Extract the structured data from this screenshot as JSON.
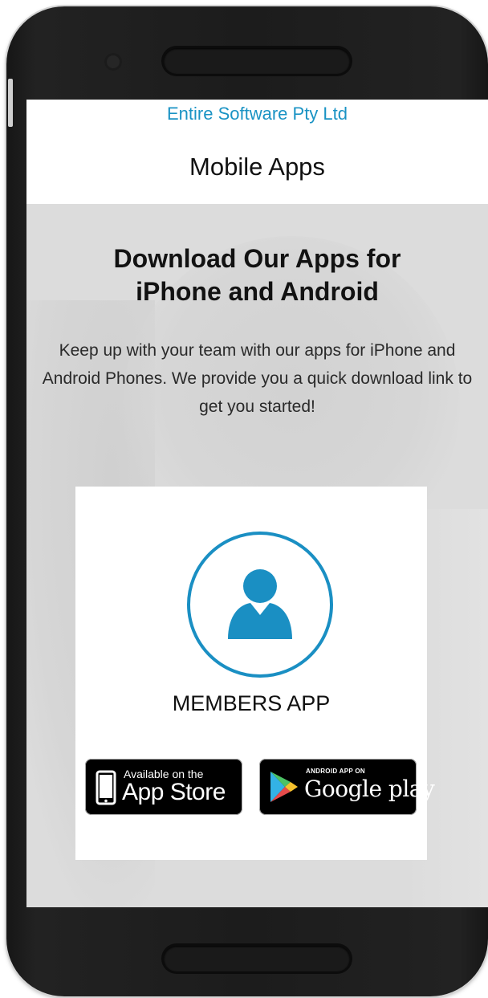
{
  "header": {
    "company": "Entire Software Pty Ltd",
    "title": "Mobile Apps"
  },
  "hero": {
    "headline": "Download Our Apps for iPhone and Android",
    "description": "Keep up with your team with our apps for iPhone and Android Phones. We provide you a quick download link to get you started!"
  },
  "card": {
    "icon": "user-icon",
    "app_name": "MEMBERS APP",
    "appstore": {
      "small": "Available on the",
      "big": "App Store",
      "icon": "iphone-icon"
    },
    "googleplay": {
      "small": "ANDROID APP ON",
      "big": "Google play",
      "icon": "play-triangle-icon"
    }
  },
  "colors": {
    "accent": "#1a93c4",
    "badge": "#000000",
    "hero_bg": "#dcdcdc"
  }
}
